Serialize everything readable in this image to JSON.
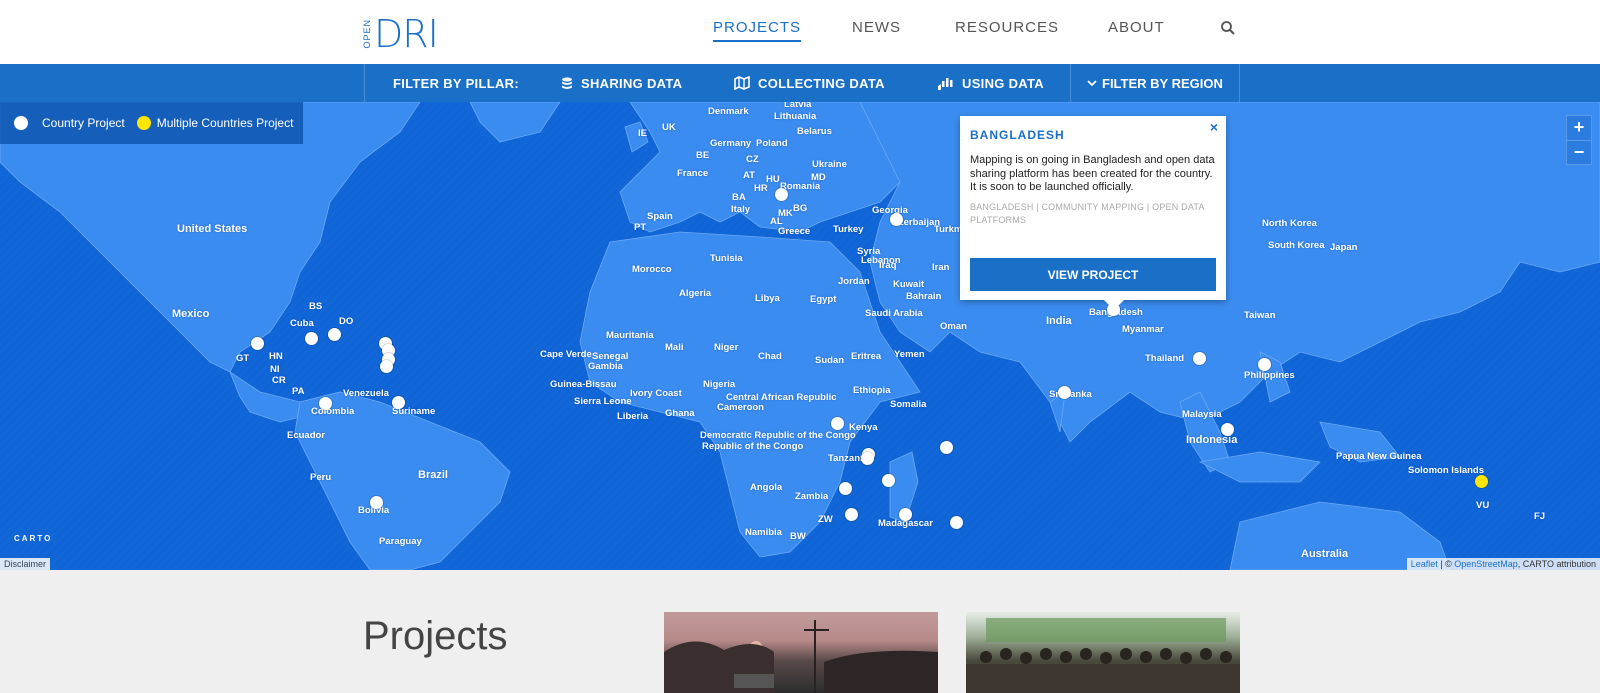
{
  "logo": {
    "open": "OPEN",
    "dri": "DRI"
  },
  "nav": {
    "projects": "PROJECTS",
    "news": "NEWS",
    "resources": "RESOURCES",
    "about": "ABOUT"
  },
  "filter": {
    "label": "FILTER BY PILLAR:",
    "sharing": "SHARING DATA",
    "collecting": "COLLECTING DATA",
    "using": "USING DATA",
    "region": "FILTER BY REGION"
  },
  "legend": {
    "country": "Country Project",
    "multiple": "Multiple Countries Project"
  },
  "zoom": {
    "in": "+",
    "out": "−"
  },
  "popup": {
    "title": "BANGLADESH",
    "body": "Mapping is on going in Bangladesh and open data sharing platform has been created for the country. It is soon to be launched officially.",
    "tags": "BANGLADESH | COMMUNITY MAPPING | OPEN DATA PLATFORMS",
    "button": "VIEW PROJECT",
    "close": "×"
  },
  "map_labels": [
    {
      "t": "Latvia"
    },
    {
      "t": "Denmark"
    },
    {
      "t": "Lithuania"
    },
    {
      "t": "IE"
    },
    {
      "t": "UK"
    },
    {
      "t": "Belarus"
    },
    {
      "t": "Germany"
    },
    {
      "t": "Poland"
    },
    {
      "t": "BE"
    },
    {
      "t": "CZ"
    },
    {
      "t": "Ukraine"
    },
    {
      "t": "MD"
    },
    {
      "t": "France"
    },
    {
      "t": "AT"
    },
    {
      "t": "HU"
    },
    {
      "t": "HR"
    },
    {
      "t": "Romania"
    },
    {
      "t": "BA"
    },
    {
      "t": "Italy"
    },
    {
      "t": "MK"
    },
    {
      "t": "BG"
    },
    {
      "t": "AL"
    },
    {
      "t": "Spain"
    },
    {
      "t": "PT"
    },
    {
      "t": "Greece"
    },
    {
      "t": "Turkey"
    },
    {
      "t": "Georgia"
    },
    {
      "t": "Azerbaijan"
    },
    {
      "t": "Turkm"
    },
    {
      "t": "Syria"
    },
    {
      "t": "Lebanon"
    },
    {
      "t": "Iraq"
    },
    {
      "t": "Iran"
    },
    {
      "t": "Morocco"
    },
    {
      "t": "Tunisia"
    },
    {
      "t": "Jordan"
    },
    {
      "t": "Kuwait"
    },
    {
      "t": "Bahrain"
    },
    {
      "t": "Algeria"
    },
    {
      "t": "Libya"
    },
    {
      "t": "Egypt"
    },
    {
      "t": "Saudi Arabia"
    },
    {
      "t": "Oman"
    },
    {
      "t": "United States"
    },
    {
      "t": "Mexico"
    },
    {
      "t": "BS"
    },
    {
      "t": "Cuba"
    },
    {
      "t": "DO"
    },
    {
      "t": "GT"
    },
    {
      "t": "HN"
    },
    {
      "t": "NI"
    },
    {
      "t": "CR"
    },
    {
      "t": "PA"
    },
    {
      "t": "Venezuela"
    },
    {
      "t": "Colombia"
    },
    {
      "t": "Suriname"
    },
    {
      "t": "Ecuador"
    },
    {
      "t": "Peru"
    },
    {
      "t": "Brazil"
    },
    {
      "t": "Bolivia"
    },
    {
      "t": "Paraguay"
    },
    {
      "t": "Mauritania"
    },
    {
      "t": "Mali"
    },
    {
      "t": "Niger"
    },
    {
      "t": "Chad"
    },
    {
      "t": "Sudan"
    },
    {
      "t": "Eritrea"
    },
    {
      "t": "Yemen"
    },
    {
      "t": "Cape Verde"
    },
    {
      "t": "Senegal"
    },
    {
      "t": "Gambia"
    },
    {
      "t": "Guinea-Bissau"
    },
    {
      "t": "Ivory Coast"
    },
    {
      "t": "Nigeria"
    },
    {
      "t": "Ethiopia"
    },
    {
      "t": "Sierra Leone"
    },
    {
      "t": "Liberia"
    },
    {
      "t": "Ghana"
    },
    {
      "t": "Central African Republic"
    },
    {
      "t": "Cameroon"
    },
    {
      "t": "Somalia"
    },
    {
      "t": "Kenya"
    },
    {
      "t": "Democratic Republic of the Congo"
    },
    {
      "t": "Republic of the Congo"
    },
    {
      "t": "Tanzania"
    },
    {
      "t": "Angola"
    },
    {
      "t": "Zambia"
    },
    {
      "t": "ZW"
    },
    {
      "t": "Madagascar"
    },
    {
      "t": "Namibia"
    },
    {
      "t": "BW"
    },
    {
      "t": "India"
    },
    {
      "t": "Bangladesh"
    },
    {
      "t": "Myanmar"
    },
    {
      "t": "Thailand"
    },
    {
      "t": "Sri Lanka"
    },
    {
      "t": "Malaysia"
    },
    {
      "t": "Indonesia"
    },
    {
      "t": "Philippines"
    },
    {
      "t": "Taiwan"
    },
    {
      "t": "North Korea"
    },
    {
      "t": "South Korea"
    },
    {
      "t": "Japan"
    },
    {
      "t": "Papua New Guinea"
    },
    {
      "t": "Solomon Islands"
    },
    {
      "t": "VU"
    },
    {
      "t": "FJ"
    },
    {
      "t": "Australia"
    }
  ],
  "map_footer": {
    "carto": "CARTO",
    "disclaimer": "Disclaimer",
    "leaflet": "Leaflet",
    "attrib_sep": " | © ",
    "osm": "OpenStreetMap",
    "carto_attr": ", CARTO attribution"
  },
  "projects": {
    "title": "Projects"
  },
  "colors": {
    "brand": "#1a6fc6",
    "map": "#1166d8",
    "multiple": "#ffe600"
  }
}
